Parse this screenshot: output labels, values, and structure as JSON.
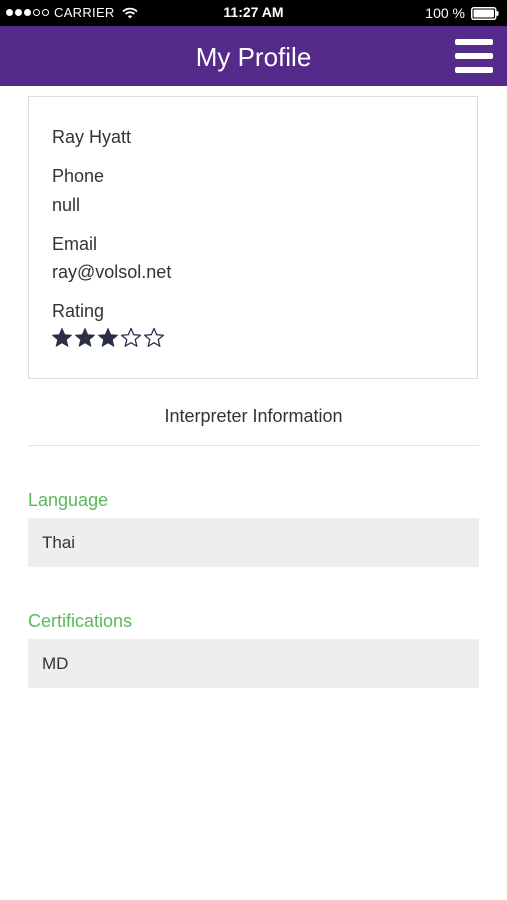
{
  "status_bar": {
    "carrier": "CARRIER",
    "time": "11:27 AM",
    "battery_percent": "100 %",
    "signal_bars": 3,
    "signal_total": 5,
    "icons": [
      "signal-icon",
      "wifi-icon",
      "battery-icon"
    ]
  },
  "header": {
    "title": "My Profile",
    "background_color": "#542a8a",
    "menu_icon": "hamburger-icon"
  },
  "profile": {
    "name": "Ray Hyatt",
    "phone_label": "Phone",
    "phone_value": "null",
    "email_label": "Email",
    "email_value": "ray@volsol.net",
    "rating_label": "Rating",
    "rating": 3,
    "rating_max": 5
  },
  "interpreter": {
    "section_title": "Interpreter Information",
    "language_label": "Language",
    "language_value": "Thai",
    "certifications_label": "Certifications",
    "certifications_value": "MD",
    "label_color": "#5cb85c"
  }
}
